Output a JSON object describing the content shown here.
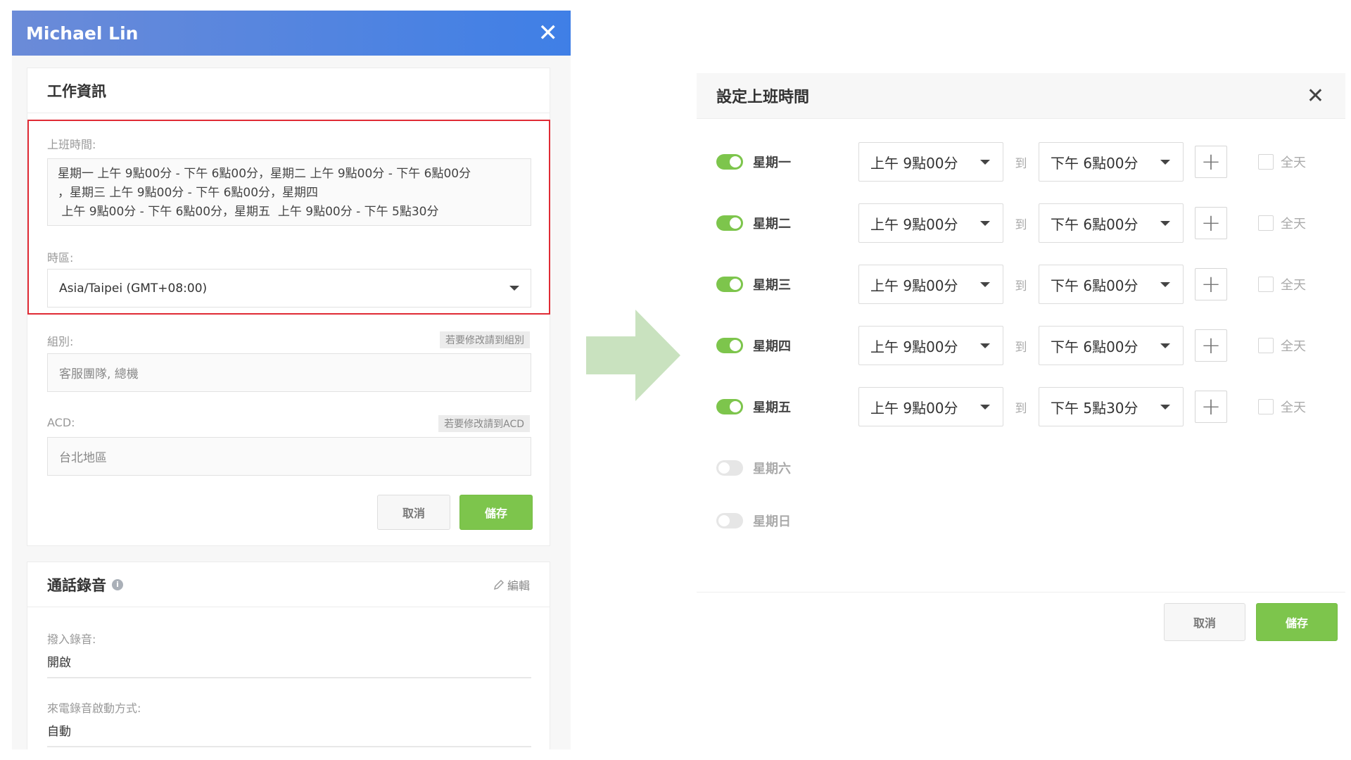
{
  "left": {
    "header_title": "Michael Lin",
    "work_section_title": "工作資訊",
    "worktime_label": "上班時間:",
    "worktime_lines": [
      "星期一  上午 9點00分 - 下午 6點00分，星期二  上午 9點00分 - 下午 6點00分",
      "，星期三  上午 9點00分 - 下午 6點00分，星期四",
      " 上午 9點00分 - 下午 6點00分，星期五  上午 9點00分 - 下午 5點30分"
    ],
    "timezone_label": "時區:",
    "timezone_value": "Asia/Taipei (GMT+08:00)",
    "group_label": "組別:",
    "group_tag": "若要修改請到組別",
    "group_value": "客服團隊, 總機",
    "acd_label": "ACD:",
    "acd_tag": "若要修改請到ACD",
    "acd_value": "台北地區",
    "cancel_label": "取消",
    "save_label": "儲存",
    "recording_title": "通話錄音",
    "edit_label": "編輯",
    "inbound_recording_label": "撥入錄音:",
    "inbound_recording_value": "開啟",
    "incoming_mode_label": "來電錄音啟動方式:",
    "incoming_mode_value": "自動"
  },
  "right": {
    "title": "設定上班時間",
    "to_label": "到",
    "allday_label": "全天",
    "cancel_label": "取消",
    "save_label": "儲存",
    "days": [
      {
        "name": "星期一",
        "enabled": true,
        "start": "上午 9點00分",
        "end": "下午 6點00分"
      },
      {
        "name": "星期二",
        "enabled": true,
        "start": "上午 9點00分",
        "end": "下午 6點00分"
      },
      {
        "name": "星期三",
        "enabled": true,
        "start": "上午 9點00分",
        "end": "下午 6點00分"
      },
      {
        "name": "星期四",
        "enabled": true,
        "start": "上午 9點00分",
        "end": "下午 6點00分"
      },
      {
        "name": "星期五",
        "enabled": true,
        "start": "上午 9點00分",
        "end": "下午 5點30分"
      },
      {
        "name": "星期六",
        "enabled": false
      },
      {
        "name": "星期日",
        "enabled": false
      }
    ]
  },
  "colors": {
    "header_gradient_start": "#6b8bd8",
    "header_gradient_end": "#3f7fe6",
    "highlight_border": "#e02b35",
    "accent_green": "#7dc54c",
    "arrow_green": "#c9e2bf"
  },
  "icons": {
    "header_close": "close-icon",
    "timezone_dropdown": "chevron-down-icon",
    "recording_info": "info-icon",
    "edit": "pencil-icon",
    "flow_arrow": "right-arrow-icon",
    "dialog_close": "close-icon",
    "add_range": "plus-icon"
  }
}
